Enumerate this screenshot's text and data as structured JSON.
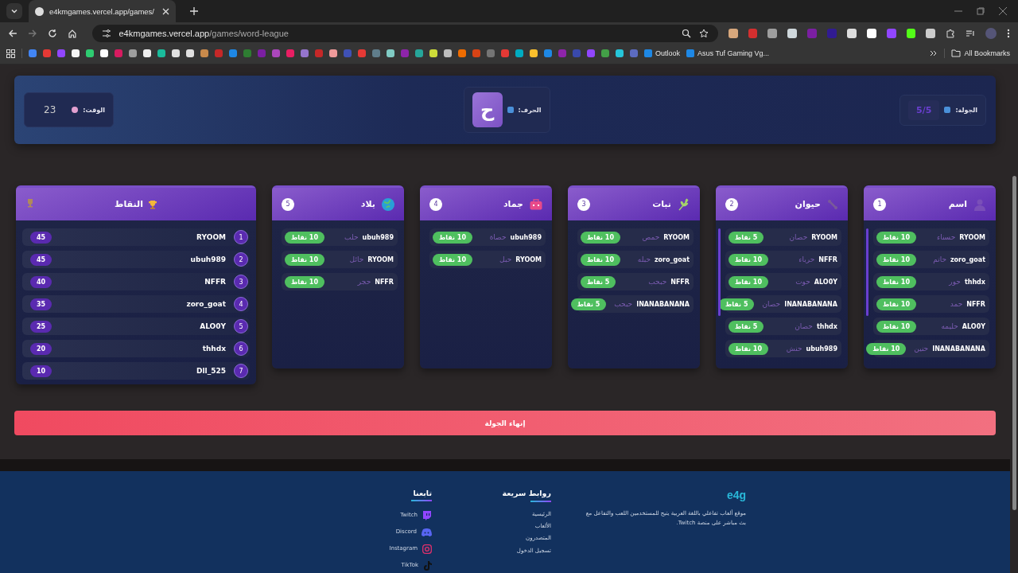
{
  "browser": {
    "tab_title": "e4kmgames.vercel.app/games/",
    "url_host": "e4kmgames.vercel.app",
    "url_path": "/games/word-league",
    "outlook_bookmark": "Outlook",
    "asus_bookmark": "Asus Tuf Gaming Vg...",
    "all_bookmarks": "All Bookmarks"
  },
  "game_header": {
    "round": {
      "label": "الجولة:",
      "value": "5/5"
    },
    "letter": {
      "label": "الحرف:",
      "value": "ح"
    },
    "timer": {
      "label": "الوقت:",
      "value": "23"
    }
  },
  "categories": [
    {
      "title": "اسم",
      "number": "1",
      "answers": [
        {
          "player": "RYOOM",
          "word": "حسناء",
          "points": "10 نقاط"
        },
        {
          "player": "zoro_goat",
          "word": "حاتم",
          "points": "10 نقاط"
        },
        {
          "player": "thhdx",
          "word": "حور",
          "points": "10 نقاط"
        },
        {
          "player": "NFFR",
          "word": "حمد",
          "points": "10 نقاط"
        },
        {
          "player": "ALO0Y",
          "word": "حليمه",
          "points": "10 نقاط"
        },
        {
          "player": "INANABANANA",
          "word": "حنين",
          "points": "10 نقاط"
        }
      ]
    },
    {
      "title": "حيوان",
      "number": "2",
      "answers": [
        {
          "player": "RYOOM",
          "word": "حصان",
          "points": "5 نقاط"
        },
        {
          "player": "NFFR",
          "word": "حرباء",
          "points": "10 نقاط"
        },
        {
          "player": "ALO0Y",
          "word": "حوت",
          "points": "10 نقاط"
        },
        {
          "player": "INANABANANA",
          "word": "حصان",
          "points": "5 نقاط"
        },
        {
          "player": "thhdx",
          "word": "حصان",
          "points": "5 نقاط"
        },
        {
          "player": "ubuh989",
          "word": "حنش",
          "points": "10 نقاط"
        }
      ]
    },
    {
      "title": "نبات",
      "number": "3",
      "answers": [
        {
          "player": "RYOOM",
          "word": "حمص",
          "points": "10 نقاط"
        },
        {
          "player": "zoro_goat",
          "word": "حبله",
          "points": "10 نقاط"
        },
        {
          "player": "NFFR",
          "word": "حبحب",
          "points": "5 نقاط"
        },
        {
          "player": "INANABANANA",
          "word": "حبحب",
          "points": "5 نقاط"
        }
      ]
    },
    {
      "title": "جماد",
      "number": "4",
      "answers": [
        {
          "player": "ubuh989",
          "word": "حصاة",
          "points": "10 نقاط"
        },
        {
          "player": "RYOOM",
          "word": "حبل",
          "points": "10 نقاط"
        }
      ]
    },
    {
      "title": "بلاد",
      "number": "5",
      "answers": [
        {
          "player": "ubuh989",
          "word": "حلب",
          "points": "10 نقاط"
        },
        {
          "player": "RYOOM",
          "word": "حائل",
          "points": "10 نقاط"
        },
        {
          "player": "NFFR",
          "word": "حجر",
          "points": "10 نقاط"
        }
      ]
    }
  ],
  "leaderboard": {
    "title": "النقاط",
    "rows": [
      {
        "rank": "1",
        "player": "RYOOM",
        "score": "45"
      },
      {
        "rank": "2",
        "player": "ubuh989",
        "score": "45"
      },
      {
        "rank": "3",
        "player": "NFFR",
        "score": "40"
      },
      {
        "rank": "4",
        "player": "zoro_goat",
        "score": "35"
      },
      {
        "rank": "5",
        "player": "ALO0Y",
        "score": "25"
      },
      {
        "rank": "6",
        "player": "thhdx",
        "score": "20"
      },
      {
        "rank": "7",
        "player": "Dll_525",
        "score": "10"
      }
    ]
  },
  "end_round_button": "إنهاء الجولة",
  "footer": {
    "brand": "e4g",
    "description": "موقع ألعاب تفاعلي باللغة العربية يتيح للمستخدمين اللعب والتفاعل مع بث مباشر على منصة Twitch.",
    "quick_links": {
      "title": "روابط سريعة",
      "links": [
        "الرئيسية",
        "الألعاب",
        "المتصدرون",
        "تسجيل الدخول"
      ]
    },
    "follow": {
      "title": "تابعنا",
      "links": [
        {
          "label": "Twitch"
        },
        {
          "label": "Discord"
        },
        {
          "label": "Instagram"
        },
        {
          "label": "TikTok"
        }
      ]
    }
  }
}
